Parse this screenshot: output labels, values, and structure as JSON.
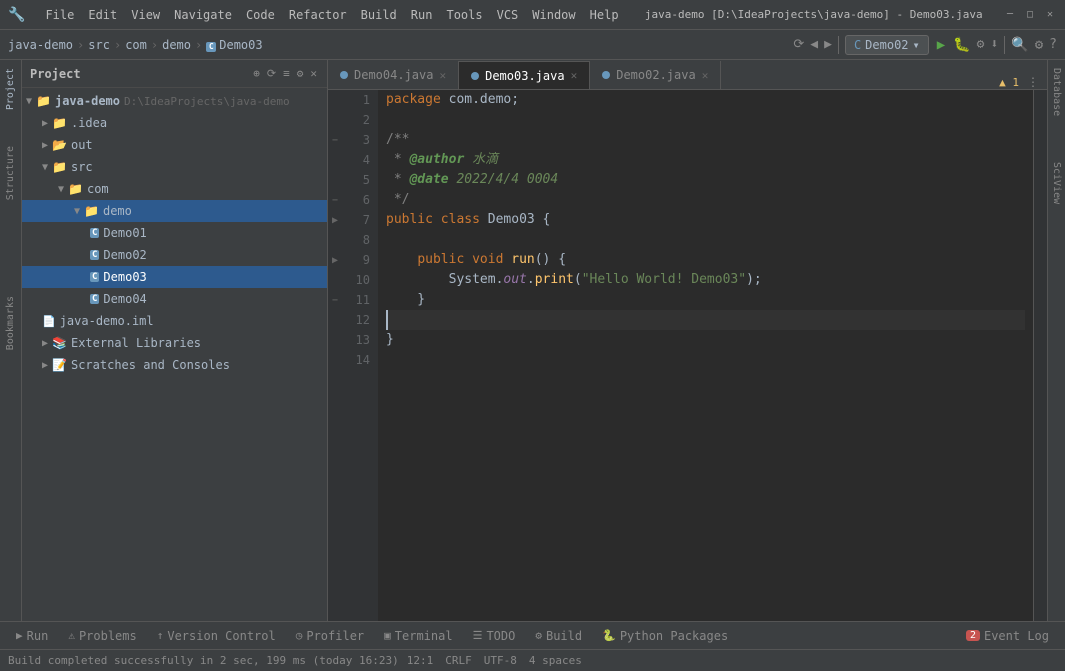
{
  "titlebar": {
    "title": "java-demo [D:\\IdeaProjects\\java-demo] - Demo03.java",
    "minimize": "─",
    "maximize": "□",
    "close": "✕"
  },
  "menubar": {
    "items": [
      "File",
      "Edit",
      "View",
      "Navigate",
      "Code",
      "Refactor",
      "Build",
      "Run",
      "Tools",
      "VCS",
      "Window",
      "Help"
    ]
  },
  "breadcrumb": {
    "parts": [
      "java-demo",
      "src",
      "com",
      "demo",
      "Demo03"
    ]
  },
  "project_panel": {
    "title": "Project",
    "tree": [
      {
        "label": "java-demo  D:\\IdeaProjects\\java-demo",
        "type": "root",
        "indent": 0
      },
      {
        "label": ".idea",
        "type": "folder",
        "indent": 1
      },
      {
        "label": "out",
        "type": "folder-open",
        "indent": 1
      },
      {
        "label": "src",
        "type": "folder",
        "indent": 1
      },
      {
        "label": "com",
        "type": "folder",
        "indent": 2
      },
      {
        "label": "demo",
        "type": "folder-selected",
        "indent": 3
      },
      {
        "label": "Demo01",
        "type": "java",
        "indent": 4
      },
      {
        "label": "Demo02",
        "type": "java",
        "indent": 4
      },
      {
        "label": "Demo03",
        "type": "java-selected",
        "indent": 4
      },
      {
        "label": "Demo04",
        "type": "java",
        "indent": 4
      },
      {
        "label": "java-demo.iml",
        "type": "iml",
        "indent": 1
      },
      {
        "label": "External Libraries",
        "type": "libs",
        "indent": 1
      },
      {
        "label": "Scratches and Consoles",
        "type": "scratches",
        "indent": 1
      }
    ]
  },
  "tabs": [
    {
      "label": "Demo04.java",
      "active": false
    },
    {
      "label": "Demo03.java",
      "active": true
    },
    {
      "label": "Demo02.java",
      "active": false
    }
  ],
  "code": {
    "lines": [
      {
        "num": 1,
        "content": "package com.demo;",
        "tokens": [
          {
            "type": "kw",
            "text": "package"
          },
          {
            "type": "plain",
            "text": " com.demo;"
          }
        ]
      },
      {
        "num": 2,
        "content": ""
      },
      {
        "num": 3,
        "content": "/**",
        "tokens": [
          {
            "type": "cm",
            "text": "/**"
          }
        ],
        "gutter": "fold"
      },
      {
        "num": 4,
        "content": " * @author 水滴",
        "tokens": [
          {
            "type": "cm",
            "text": " * "
          },
          {
            "type": "cm-tag",
            "text": "@author"
          },
          {
            "type": "cm-val",
            "text": " 水滴"
          }
        ]
      },
      {
        "num": 5,
        "content": " * @date 2022/4/4 0004",
        "tokens": [
          {
            "type": "cm",
            "text": " * "
          },
          {
            "type": "cm-tag",
            "text": "@date"
          },
          {
            "type": "cm-val",
            "text": " 2022/4/4 0004"
          }
        ]
      },
      {
        "num": 6,
        "content": " */",
        "tokens": [
          {
            "type": "cm",
            "text": " */"
          }
        ],
        "gutter": "fold"
      },
      {
        "num": 7,
        "content": "public class Demo03 {",
        "tokens": [
          {
            "type": "kw",
            "text": "public"
          },
          {
            "type": "plain",
            "text": " "
          },
          {
            "type": "kw",
            "text": "class"
          },
          {
            "type": "plain",
            "text": " Demo03 {"
          }
        ],
        "gutter": "run"
      },
      {
        "num": 8,
        "content": ""
      },
      {
        "num": 9,
        "content": "    public void run() {",
        "tokens": [
          {
            "type": "plain",
            "text": "    "
          },
          {
            "type": "kw",
            "text": "public"
          },
          {
            "type": "plain",
            "text": " "
          },
          {
            "type": "kw",
            "text": "void"
          },
          {
            "type": "plain",
            "text": " "
          },
          {
            "type": "fn",
            "text": "run"
          },
          {
            "type": "plain",
            "text": "() {"
          }
        ],
        "gutter": "run"
      },
      {
        "num": 10,
        "content": "        System.out.print(\"Hello World! Demo03\");",
        "tokens": [
          {
            "type": "plain",
            "text": "        System."
          },
          {
            "type": "out-it",
            "text": "out"
          },
          {
            "type": "plain",
            "text": "."
          },
          {
            "type": "fn",
            "text": "print"
          },
          {
            "type": "plain",
            "text": "("
          },
          {
            "type": "string",
            "text": "\"Hello World! Demo03\""
          },
          {
            "type": "plain",
            "text": ");"
          }
        ]
      },
      {
        "num": 11,
        "content": "    }",
        "tokens": [
          {
            "type": "plain",
            "text": "    }"
          }
        ],
        "gutter": "fold"
      },
      {
        "num": 12,
        "content": "",
        "current": true
      },
      {
        "num": 13,
        "content": "}",
        "tokens": [
          {
            "type": "plain",
            "text": "}"
          }
        ]
      },
      {
        "num": 14,
        "content": ""
      }
    ],
    "warnings": "▲ 1"
  },
  "bottom_tabs": [
    {
      "label": "Run",
      "icon": "▶",
      "active": false
    },
    {
      "label": "Problems",
      "icon": "⚠",
      "active": false
    },
    {
      "label": "Version Control",
      "icon": "↑",
      "active": false
    },
    {
      "label": "Profiler",
      "icon": "◷",
      "active": false
    },
    {
      "label": "Terminal",
      "icon": "▣",
      "active": false
    },
    {
      "label": "TODO",
      "icon": "☰",
      "active": false
    },
    {
      "label": "Build",
      "icon": "⚙",
      "active": false
    },
    {
      "label": "Python Packages",
      "icon": "🐍",
      "active": false
    }
  ],
  "event_log": {
    "label": "Event Log",
    "count": 2
  },
  "statusbar": {
    "message": "Build completed successfully in 2 sec, 199 ms (today 16:23)",
    "position": "12:1",
    "line_ending": "CRLF",
    "encoding": "UTF-8",
    "indent": "4 spaces"
  },
  "config": {
    "run_config": "Demo02"
  },
  "right_panels": [
    "Database",
    "SciView"
  ],
  "left_panels": [
    "Project",
    "Structure",
    "Bookmarks"
  ]
}
